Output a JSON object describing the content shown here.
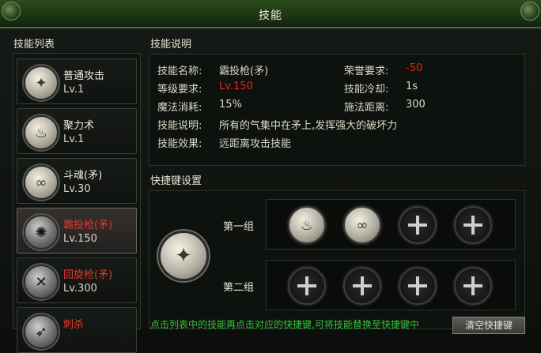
{
  "window": {
    "title": "技能"
  },
  "skill_list": {
    "title": "技能列表",
    "items": [
      {
        "name": "普通攻击",
        "level": "Lv.1",
        "icon": "sword-icon",
        "selected": false
      },
      {
        "name": "聚力术",
        "level": "Lv.1",
        "icon": "flame-icon",
        "selected": false
      },
      {
        "name": "斗魂(矛)",
        "level": "Lv.30",
        "icon": "spiral-icon",
        "selected": false
      },
      {
        "name": "霸投枪(矛)",
        "level": "Lv.150",
        "icon": "burst-icon",
        "selected": true
      },
      {
        "name": "回旋枪(矛)",
        "level": "Lv.300",
        "icon": "cross-spear-icon",
        "selected": false
      },
      {
        "name": "刺杀",
        "level": "",
        "icon": "thrust-icon",
        "selected": false
      }
    ]
  },
  "skill_desc": {
    "title": "技能说明",
    "name_label": "技能名称:",
    "name_value": "霸投枪(矛)",
    "honor_label": "荣誉要求:",
    "honor_value": "-50",
    "level_label": "等级要求:",
    "level_value": "Lv.150",
    "cooldown_label": "技能冷却:",
    "cooldown_value": "1s",
    "mana_label": "魔法消耗:",
    "mana_value": "15%",
    "range_label": "施法距离:",
    "range_value": "300",
    "desc_label": "技能说明:",
    "desc_value": "所有的气集中在矛上,发挥强大的破坏力",
    "effect_label": "技能效果:",
    "effect_value": "远距离攻击技能"
  },
  "shortcut": {
    "title": "快捷键设置",
    "group1_label": "第一组",
    "group2_label": "第二组",
    "hint": "点击列表中的技能再点击对应的快捷键,可将技能替换至快捷键中",
    "clear_button": "清空快捷键"
  },
  "colors": {
    "accent_red": "#e2241b",
    "hint_green": "#35c43a"
  }
}
